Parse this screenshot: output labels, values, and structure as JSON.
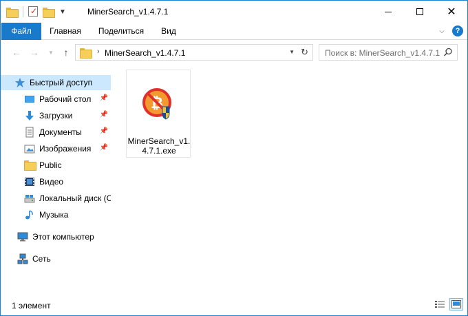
{
  "window": {
    "title": "MinerSearch_v1.4.7.1",
    "close_glyph": "✕"
  },
  "ribbon": {
    "tabs": [
      {
        "label": "Файл"
      },
      {
        "label": "Главная"
      },
      {
        "label": "Поделиться"
      },
      {
        "label": "Вид"
      }
    ],
    "help_glyph": "?"
  },
  "address": {
    "breadcrumb": "MinerSearch_v1.4.7.1",
    "separator": "›"
  },
  "search": {
    "placeholder": "Поиск в: MinerSearch_v1.4.7.1"
  },
  "nav": {
    "items": [
      {
        "label": "Быстрый доступ",
        "icon": "star-icon"
      },
      {
        "label": "Рабочий стол",
        "icon": "desktop-icon",
        "pinned": true
      },
      {
        "label": "Загрузки",
        "icon": "download-icon",
        "pinned": true
      },
      {
        "label": "Документы",
        "icon": "document-icon",
        "pinned": true
      },
      {
        "label": "Изображения",
        "icon": "pictures-icon",
        "pinned": true
      },
      {
        "label": "Public",
        "icon": "folder-icon"
      },
      {
        "label": "Видео",
        "icon": "video-icon"
      },
      {
        "label": "Локальный диск (C",
        "icon": "drive-icon"
      },
      {
        "label": "Музыка",
        "icon": "music-icon"
      },
      {
        "label": "Этот компьютер",
        "icon": "computer-icon"
      },
      {
        "label": "Сеть",
        "icon": "network-icon"
      }
    ]
  },
  "files": [
    {
      "name": "MinerSearch_v1.4.7.1.exe",
      "icon": "minersearch-app-icon"
    }
  ],
  "status": {
    "item_count": "1 элемент"
  },
  "colors": {
    "accent": "#1979ca",
    "selection": "#cce8ff",
    "border": "#1883d7"
  }
}
